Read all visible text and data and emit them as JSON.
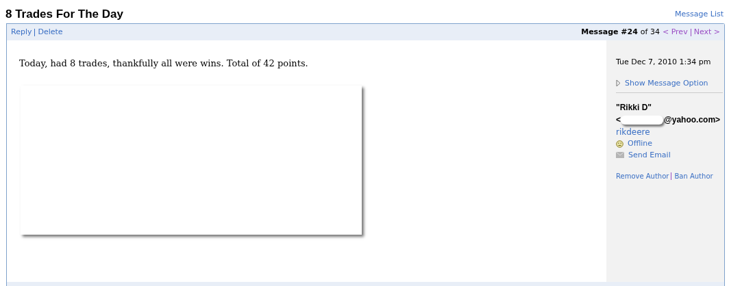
{
  "title": "8 Trades For The Day",
  "message_list_link": "Message List",
  "toolbar": {
    "actions": [
      "Reply",
      "Delete"
    ],
    "position_label": "Message #24",
    "position_of": "of 34",
    "prev": "< Prev",
    "next": "Next >"
  },
  "body": {
    "text": "Today, had 8 trades, thankfully all were wins. Total of 42 points."
  },
  "sidebar": {
    "date": "Tue Dec 7, 2010 1:34 pm",
    "show_options": "Show Message Option",
    "author_name": "\"Rikki D\"",
    "email_start": "<",
    "email_end": "@yahoo.com>",
    "username": "rikdeere",
    "status": "Offline",
    "send_email": "Send Email",
    "admin_actions": [
      "Remove Author",
      "Ban Author"
    ]
  }
}
